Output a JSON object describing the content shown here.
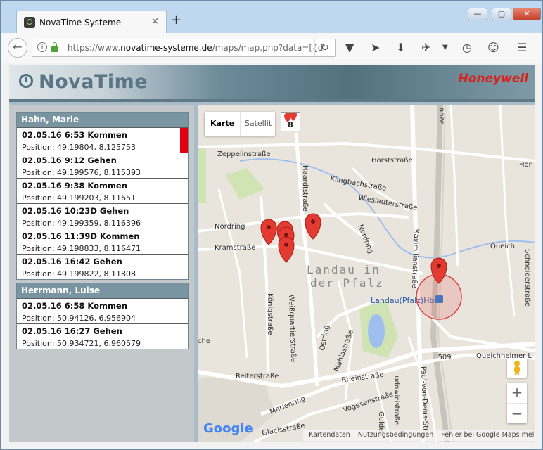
{
  "browser": {
    "tab_title": "NovaTime Systeme",
    "tab_close": "×",
    "new_tab": "+",
    "url_prefix": "https://www.",
    "url_domain": "novatime-systeme.de",
    "url_path": "/maps/map.php?data=[{d",
    "window_controls": {
      "minimize": "—",
      "maximize": "▢",
      "close": "✕"
    }
  },
  "header": {
    "logo_text": "NovaTime",
    "brand": "Honeywell"
  },
  "people": [
    {
      "name": "Hahn, Marie",
      "entries": [
        {
          "line1": "02.05.16 6:53 Kommen",
          "line2": "Position: 49.19804, 8.125753",
          "marked": true
        },
        {
          "line1": "02.05.16 9:12 Gehen",
          "line2": "Position: 49.199576, 8.115393",
          "marked": false
        },
        {
          "line1": "02.05.16 9:38 Kommen",
          "line2": "Position: 49.199203, 8.11651",
          "marked": false
        },
        {
          "line1": "02.05.16 10:23D Gehen",
          "line2": "Position: 49.199359, 8.116396",
          "marked": false
        },
        {
          "line1": "02.05.16 11:39D Kommen",
          "line2": "Position: 49.198833, 8.116471",
          "marked": false
        },
        {
          "line1": "02.05.16 16:42 Gehen",
          "line2": "Position: 49.199822, 8.11808",
          "marked": false
        }
      ]
    },
    {
      "name": "Herrmann, Luise",
      "entries": [
        {
          "line1": "02.05.16 6:58 Kommen",
          "line2": "Position: 50.94126, 6.956904",
          "marked": false
        },
        {
          "line1": "02.05.16 16:27 Gehen",
          "line2": "Position: 50.934721, 6.960579",
          "marked": false
        }
      ]
    }
  ],
  "map": {
    "type_buttons": {
      "map": "Karte",
      "satellite": "Satellit"
    },
    "cluster_count": "8",
    "zoom_in": "+",
    "zoom_out": "−",
    "google_logo": "Google",
    "attribution": {
      "data": "Kartendaten",
      "terms": "Nutzungsbedingungen",
      "report": "Fehler bei Google Maps melden"
    },
    "city_label_1": "Landau in",
    "city_label_2": "der Pfalz",
    "station": "Landau(Pfalz)Hbf",
    "streets": {
      "zeppelin": "Zeppelinstraße",
      "horst": "Horststraße",
      "klingbach": "Klingbachstraße",
      "wieslauter": "Wieslauterstraße",
      "haardt": "Haardtstraße",
      "nordring": "Nordring",
      "nordring2": "Nordring",
      "kram": "Kramstraße",
      "queich": "Queich",
      "maximilian": "Maximilianstraße",
      "schneider": "Schneiderstraße",
      "koenig": "Königstraße",
      "weissquartier": "Weißquartierstraße",
      "reiter": "Reiterstraße",
      "rhein": "Rheinstraße",
      "ostring": "Ostring",
      "mahla": "Mahlastraße",
      "ludwig": "Ludowicistraße",
      "vogesen": "Vogesenstraße",
      "marien": "Marienring",
      "glacis": "Glacisstraße",
      "l509": "L509",
      "queichheimer": "Queichheimer L",
      "paulvd": "Paul-von-Denis-Str",
      "hor": "Hor",
      "anze": "anze",
      "che": "che",
      "gulden": "Gulden"
    }
  }
}
